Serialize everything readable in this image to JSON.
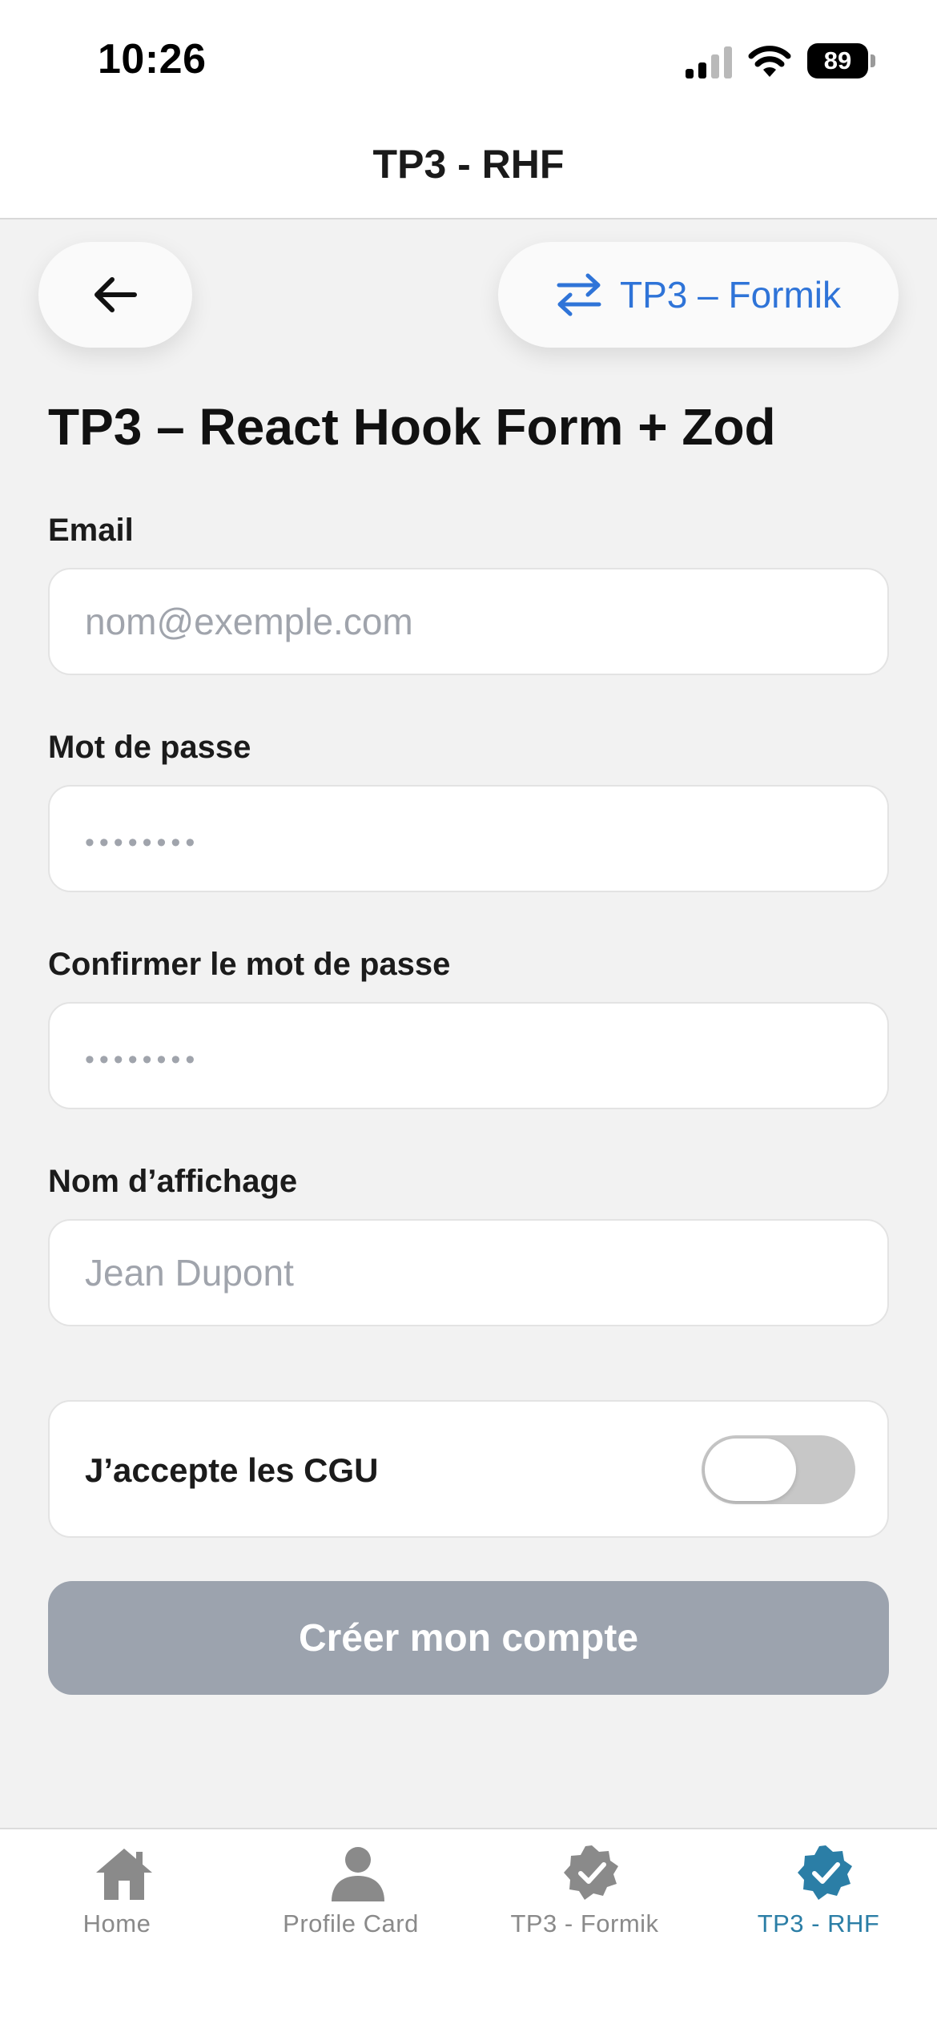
{
  "status_bar": {
    "time": "10:26",
    "battery": "89",
    "icons": [
      "signal-icon",
      "wifi-icon",
      "battery-icon"
    ]
  },
  "header": {
    "title": "TP3 - RHF"
  },
  "top_actions": {
    "back_icon": "arrow-left-icon",
    "switch_icon": "swap-arrows-icon",
    "switch_label": "TP3 – Formik"
  },
  "form": {
    "title": "TP3 – React Hook Form + Zod",
    "email": {
      "label": "Email",
      "placeholder": "nom@exemple.com",
      "value": ""
    },
    "password": {
      "label": "Mot de passe",
      "placeholder": "••••••••",
      "value": ""
    },
    "confirm_password": {
      "label": "Confirmer le mot de passe",
      "placeholder": "••••••••",
      "value": ""
    },
    "display_name": {
      "label": "Nom d’affichage",
      "placeholder": "Jean Dupont",
      "value": ""
    },
    "cgu": {
      "label": "J’accepte les CGU",
      "checked": false
    },
    "submit_label": "Créer mon compte",
    "submit_disabled": true
  },
  "tab_bar": {
    "items": [
      {
        "label": "Home",
        "icon": "home-icon",
        "active": false
      },
      {
        "label": "Profile Card",
        "icon": "person-icon",
        "active": false
      },
      {
        "label": "TP3 - Formik",
        "icon": "verified-badge-icon",
        "active": false
      },
      {
        "label": "TP3 - RHF",
        "icon": "verified-badge-icon",
        "active": true
      }
    ]
  },
  "colors": {
    "accent_blue": "#2f74d8",
    "active_tab": "#2b7ea6",
    "inactive_tab": "#8a8a8a",
    "disabled_button": "#9ca3ae",
    "background": "#f2f2f2"
  }
}
